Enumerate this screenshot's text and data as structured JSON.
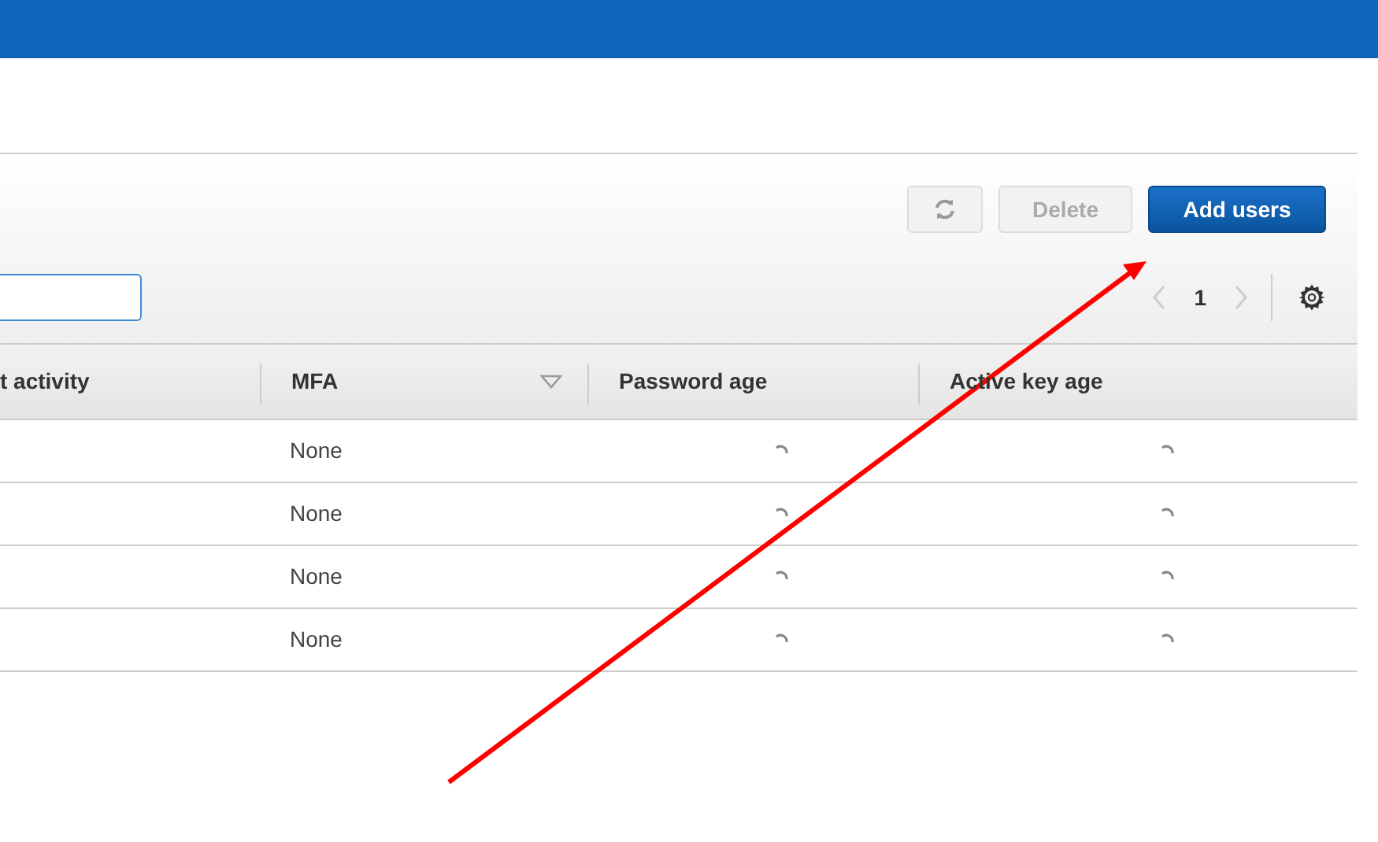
{
  "toolbar": {
    "buttons": [
      {
        "kind": "refresh",
        "disabled": false
      },
      {
        "kind": "text",
        "label": "Delete",
        "disabled": true
      },
      {
        "kind": "primary",
        "label": "Add users",
        "disabled": false
      }
    ]
  },
  "pagination": {
    "page": "1",
    "prev_disabled": true,
    "next_disabled": true
  },
  "table": {
    "columns": [
      {
        "label": "t activity",
        "sortable": false
      },
      {
        "label": "MFA",
        "sortable": true
      },
      {
        "label": "Password age",
        "sortable": false
      },
      {
        "label": "Active key age",
        "sortable": false
      }
    ],
    "rows": [
      {
        "mfa": "None",
        "password_loading": true,
        "key_loading": true
      },
      {
        "mfa": "None",
        "password_loading": true,
        "key_loading": true
      },
      {
        "mfa": "None",
        "password_loading": true,
        "key_loading": true
      },
      {
        "mfa": "None",
        "password_loading": true,
        "key_loading": true
      }
    ]
  }
}
